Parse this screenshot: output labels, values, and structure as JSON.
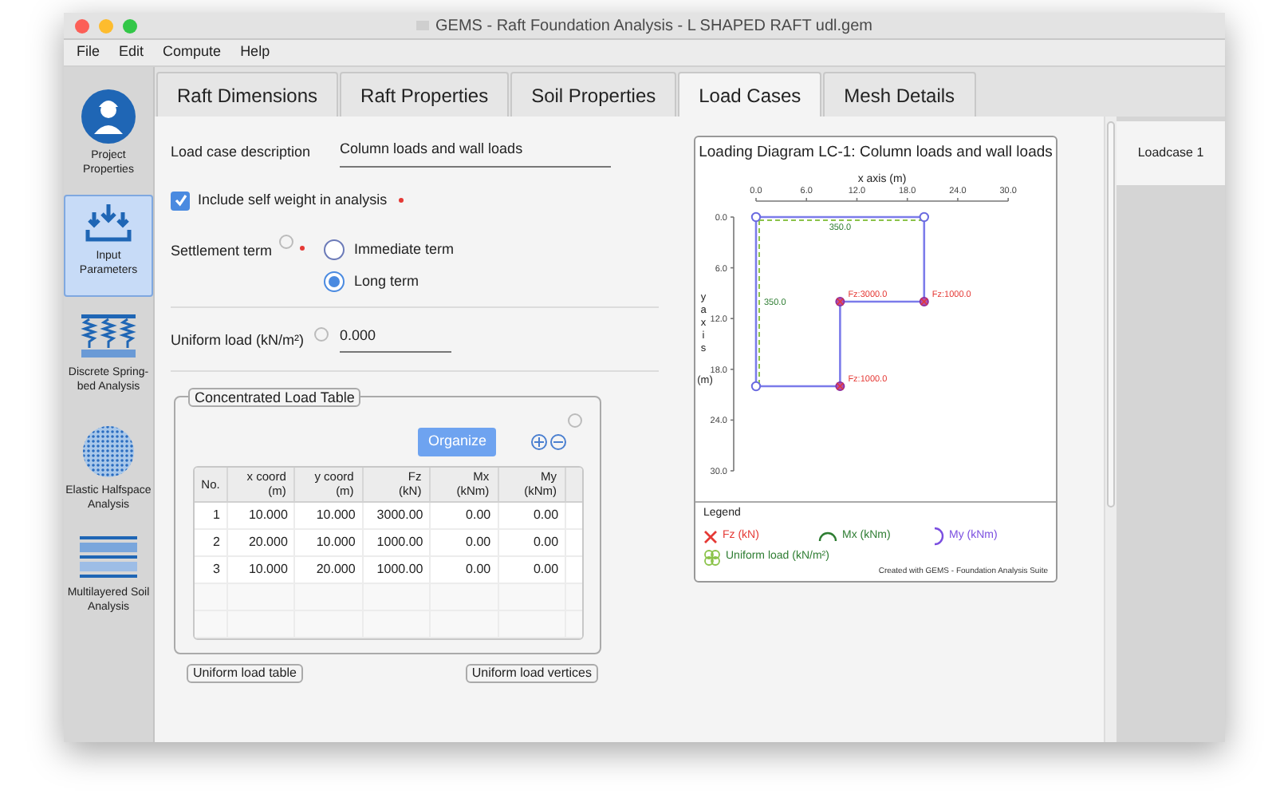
{
  "window": {
    "title": "GEMS - Raft Foundation Analysis - L SHAPED RAFT udl.gem"
  },
  "menu": [
    "File",
    "Edit",
    "Compute",
    "Help"
  ],
  "sidebar": {
    "items": [
      {
        "kind": "person",
        "label": "Project Properties",
        "selected": false
      },
      {
        "kind": "arrows",
        "label": "Input Parameters",
        "selected": true
      },
      {
        "kind": "springs",
        "label": "Discrete Spring-bed Analysis",
        "selected": false
      },
      {
        "kind": "dots",
        "label": "Elastic Halfspace Analysis",
        "selected": false
      },
      {
        "kind": "layers",
        "label": "Multilayered Soil Analysis",
        "selected": false
      }
    ]
  },
  "tabs": [
    {
      "label": "Raft Dimensions",
      "selected": false
    },
    {
      "label": "Raft Properties",
      "selected": false
    },
    {
      "label": "Soil Properties",
      "selected": false
    },
    {
      "label": "Load Cases",
      "selected": true
    },
    {
      "label": "Mesh Details",
      "selected": false
    }
  ],
  "form": {
    "description": {
      "label": "Load case description",
      "value": "Column loads and wall loads"
    },
    "self_weight": {
      "label": "Include self weight in analysis",
      "checked": true,
      "required": true
    },
    "settlement": {
      "label": "Settlement term",
      "required": true,
      "options": [
        {
          "label": "Immediate term",
          "selected": false
        },
        {
          "label": "Long term",
          "selected": true
        }
      ]
    },
    "uniform_load": {
      "label": "Uniform load (kN/m²)",
      "value": "0.000"
    }
  },
  "load_table": {
    "title": "Concentrated Load Table",
    "organize": "Organize",
    "columns": [
      {
        "label": "No."
      },
      {
        "label": "x coord",
        "unit": "(m)"
      },
      {
        "label": "y coord",
        "unit": "(m)"
      },
      {
        "label": "Fz",
        "unit": "(kN)"
      },
      {
        "label": "Mx",
        "unit": "(kNm)"
      },
      {
        "label": "My",
        "unit": "(kNm)"
      }
    ],
    "rows": [
      [
        "1",
        "10.000",
        "10.000",
        "3000.00",
        "0.00",
        "0.00"
      ],
      [
        "2",
        "20.000",
        "10.000",
        "1000.00",
        "0.00",
        "0.00"
      ],
      [
        "3",
        "10.000",
        "20.000",
        "1000.00",
        "0.00",
        "0.00"
      ]
    ]
  },
  "bottom_groups": [
    "Uniform load table",
    "Uniform load vertices"
  ],
  "diagram": {
    "title": "Loading Diagram LC-1: Column loads and wall loads",
    "xlabel": "x axis (m)",
    "ylabel": "y axis",
    "yunit": "(m)",
    "xticks": [
      "0.0",
      "6.0",
      "12.0",
      "18.0",
      "24.0",
      "30.0"
    ],
    "yticks": [
      "0.0",
      "6.0",
      "12.0",
      "18.0",
      "24.0",
      "30.0"
    ],
    "wall_loads": [
      "350.0",
      "350.0"
    ],
    "point_loads": [
      "Fz:3000.0",
      "Fz:1000.0",
      "Fz:1000.0"
    ],
    "legend_title": "Legend",
    "legend": [
      {
        "kind": "fz",
        "label": "Fz (kN)"
      },
      {
        "kind": "mx",
        "label": "Mx (kNm)"
      },
      {
        "kind": "my",
        "label": "My (kNm)"
      },
      {
        "kind": "uniform",
        "label": "Uniform load (kN/m²)"
      }
    ],
    "credit": "Created with GEMS - Foundation Analysis Suite"
  },
  "side_tabs": [
    {
      "label": "Loadcase 1",
      "selected": true
    }
  ]
}
